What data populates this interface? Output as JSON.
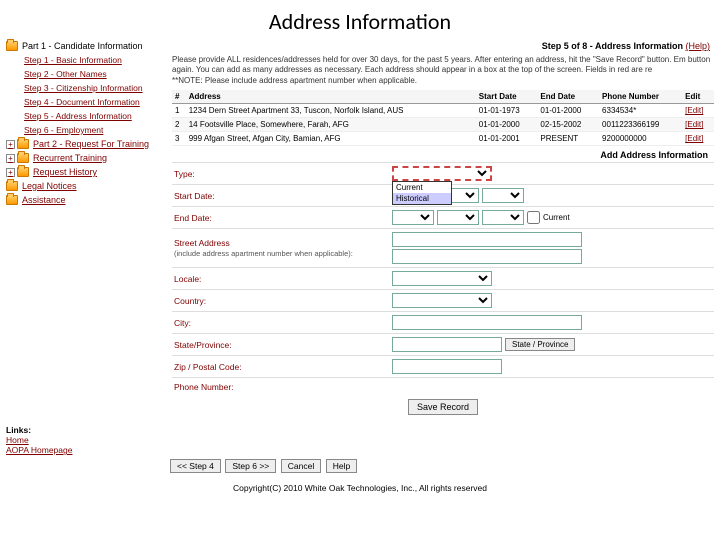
{
  "title": "Address Information",
  "sidebar": {
    "part1": {
      "label": "Part 1 - Candidate Information",
      "steps": [
        "Step 1 - Basic Information",
        "Step 2 - Other Names",
        "Step 3 - Citizenship Information",
        "Step 4 - Document Information",
        "Step 5 - Address Information",
        "Step 6 - Employment"
      ]
    },
    "part2": {
      "label": "Part 2 - Request For Training"
    },
    "recurrent": "Recurrent Training",
    "history": "Request History",
    "legal": "Legal Notices",
    "assistance": "Assistance"
  },
  "step_header": {
    "text": "Step 5 of 8 - Address Information",
    "help": "(Help)"
  },
  "instructions": {
    "p1": "Please provide ALL residences/addresses held for over 30 days, for the past 5 years. After entering an address, hit the \"Save Record\" button. Em button again. You can add as many addresses as necessary. Each address should appear in a box at the top of the screen. Fields in red are re",
    "p2": "**NOTE: Please include address apartment number when applicable."
  },
  "table": {
    "headers": [
      "#",
      "Address",
      "Start Date",
      "End Date",
      "Phone Number",
      "Edit"
    ],
    "rows": [
      {
        "num": "1",
        "addr": "1234 Dern Street Apartment 33, Tuscon, Norfolk Island, AUS",
        "start": "01-01-1973",
        "end": "01-01-2000",
        "phone": "6334534*",
        "edit": "[Edit]"
      },
      {
        "num": "2",
        "addr": "14 Footsville Place, Somewhere, Farah, AFG",
        "start": "01-01-2000",
        "end": "02-15-2002",
        "phone": "0011223366199",
        "edit": "[Edit]"
      },
      {
        "num": "3",
        "addr": "999 Afgan Street, Afgan City, Bamian, AFG",
        "start": "01-01-2001",
        "end": "PRESENT",
        "phone": "9200000000",
        "edit": "[Edit]"
      }
    ]
  },
  "section_title": "Add Address Information",
  "form": {
    "type": "Type:",
    "type_options": [
      "Current",
      "Historical"
    ],
    "start_date": "Start Date:",
    "end_date": "End Date:",
    "current_chk": "Current",
    "street": "Street Address",
    "street_sub": "(include address apartment number when applicable):",
    "locale": "Locale:",
    "country": "Country:",
    "city": "City:",
    "state": "State/Province:",
    "state_btn": "State / Province",
    "zip": "Zip / Postal Code:",
    "phone": "Phone Number:",
    "save": "Save Record"
  },
  "links": {
    "hdr": "Links:",
    "home": "Home",
    "aopa": "AOPA Homepage"
  },
  "nav": {
    "prev": "<< Step 4",
    "next": "Step 6 >>",
    "cancel": "Cancel",
    "help": "Help"
  },
  "copyright": "Copyright(C) 2010 White Oak Technologies, Inc., All rights reserved"
}
